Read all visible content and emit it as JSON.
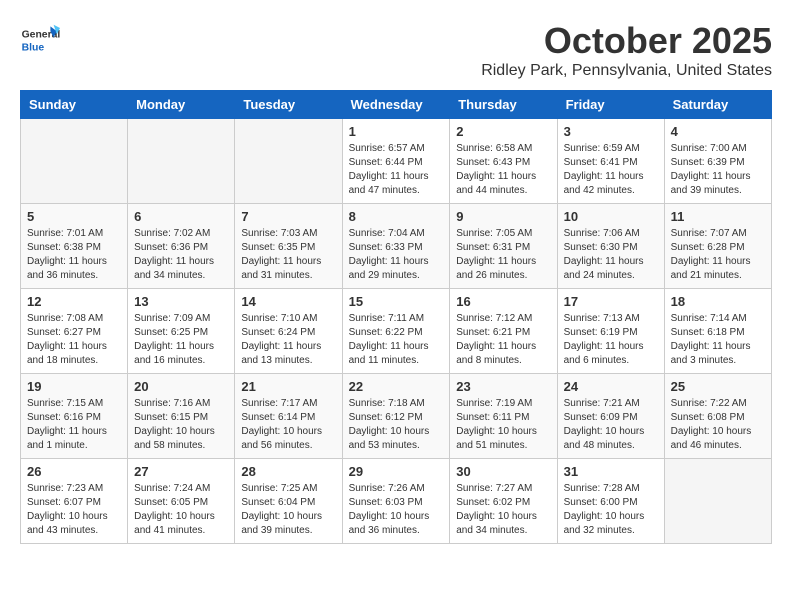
{
  "header": {
    "logo_general": "General",
    "logo_blue": "Blue",
    "title": "October 2025",
    "subtitle": "Ridley Park, Pennsylvania, United States"
  },
  "days_of_week": [
    "Sunday",
    "Monday",
    "Tuesday",
    "Wednesday",
    "Thursday",
    "Friday",
    "Saturday"
  ],
  "weeks": [
    [
      {
        "day": "",
        "info": ""
      },
      {
        "day": "",
        "info": ""
      },
      {
        "day": "",
        "info": ""
      },
      {
        "day": "1",
        "info": "Sunrise: 6:57 AM\nSunset: 6:44 PM\nDaylight: 11 hours\nand 47 minutes."
      },
      {
        "day": "2",
        "info": "Sunrise: 6:58 AM\nSunset: 6:43 PM\nDaylight: 11 hours\nand 44 minutes."
      },
      {
        "day": "3",
        "info": "Sunrise: 6:59 AM\nSunset: 6:41 PM\nDaylight: 11 hours\nand 42 minutes."
      },
      {
        "day": "4",
        "info": "Sunrise: 7:00 AM\nSunset: 6:39 PM\nDaylight: 11 hours\nand 39 minutes."
      }
    ],
    [
      {
        "day": "5",
        "info": "Sunrise: 7:01 AM\nSunset: 6:38 PM\nDaylight: 11 hours\nand 36 minutes."
      },
      {
        "day": "6",
        "info": "Sunrise: 7:02 AM\nSunset: 6:36 PM\nDaylight: 11 hours\nand 34 minutes."
      },
      {
        "day": "7",
        "info": "Sunrise: 7:03 AM\nSunset: 6:35 PM\nDaylight: 11 hours\nand 31 minutes."
      },
      {
        "day": "8",
        "info": "Sunrise: 7:04 AM\nSunset: 6:33 PM\nDaylight: 11 hours\nand 29 minutes."
      },
      {
        "day": "9",
        "info": "Sunrise: 7:05 AM\nSunset: 6:31 PM\nDaylight: 11 hours\nand 26 minutes."
      },
      {
        "day": "10",
        "info": "Sunrise: 7:06 AM\nSunset: 6:30 PM\nDaylight: 11 hours\nand 24 minutes."
      },
      {
        "day": "11",
        "info": "Sunrise: 7:07 AM\nSunset: 6:28 PM\nDaylight: 11 hours\nand 21 minutes."
      }
    ],
    [
      {
        "day": "12",
        "info": "Sunrise: 7:08 AM\nSunset: 6:27 PM\nDaylight: 11 hours\nand 18 minutes."
      },
      {
        "day": "13",
        "info": "Sunrise: 7:09 AM\nSunset: 6:25 PM\nDaylight: 11 hours\nand 16 minutes."
      },
      {
        "day": "14",
        "info": "Sunrise: 7:10 AM\nSunset: 6:24 PM\nDaylight: 11 hours\nand 13 minutes."
      },
      {
        "day": "15",
        "info": "Sunrise: 7:11 AM\nSunset: 6:22 PM\nDaylight: 11 hours\nand 11 minutes."
      },
      {
        "day": "16",
        "info": "Sunrise: 7:12 AM\nSunset: 6:21 PM\nDaylight: 11 hours\nand 8 minutes."
      },
      {
        "day": "17",
        "info": "Sunrise: 7:13 AM\nSunset: 6:19 PM\nDaylight: 11 hours\nand 6 minutes."
      },
      {
        "day": "18",
        "info": "Sunrise: 7:14 AM\nSunset: 6:18 PM\nDaylight: 11 hours\nand 3 minutes."
      }
    ],
    [
      {
        "day": "19",
        "info": "Sunrise: 7:15 AM\nSunset: 6:16 PM\nDaylight: 11 hours\nand 1 minute."
      },
      {
        "day": "20",
        "info": "Sunrise: 7:16 AM\nSunset: 6:15 PM\nDaylight: 10 hours\nand 58 minutes."
      },
      {
        "day": "21",
        "info": "Sunrise: 7:17 AM\nSunset: 6:14 PM\nDaylight: 10 hours\nand 56 minutes."
      },
      {
        "day": "22",
        "info": "Sunrise: 7:18 AM\nSunset: 6:12 PM\nDaylight: 10 hours\nand 53 minutes."
      },
      {
        "day": "23",
        "info": "Sunrise: 7:19 AM\nSunset: 6:11 PM\nDaylight: 10 hours\nand 51 minutes."
      },
      {
        "day": "24",
        "info": "Sunrise: 7:21 AM\nSunset: 6:09 PM\nDaylight: 10 hours\nand 48 minutes."
      },
      {
        "day": "25",
        "info": "Sunrise: 7:22 AM\nSunset: 6:08 PM\nDaylight: 10 hours\nand 46 minutes."
      }
    ],
    [
      {
        "day": "26",
        "info": "Sunrise: 7:23 AM\nSunset: 6:07 PM\nDaylight: 10 hours\nand 43 minutes."
      },
      {
        "day": "27",
        "info": "Sunrise: 7:24 AM\nSunset: 6:05 PM\nDaylight: 10 hours\nand 41 minutes."
      },
      {
        "day": "28",
        "info": "Sunrise: 7:25 AM\nSunset: 6:04 PM\nDaylight: 10 hours\nand 39 minutes."
      },
      {
        "day": "29",
        "info": "Sunrise: 7:26 AM\nSunset: 6:03 PM\nDaylight: 10 hours\nand 36 minutes."
      },
      {
        "day": "30",
        "info": "Sunrise: 7:27 AM\nSunset: 6:02 PM\nDaylight: 10 hours\nand 34 minutes."
      },
      {
        "day": "31",
        "info": "Sunrise: 7:28 AM\nSunset: 6:00 PM\nDaylight: 10 hours\nand 32 minutes."
      },
      {
        "day": "",
        "info": ""
      }
    ]
  ]
}
